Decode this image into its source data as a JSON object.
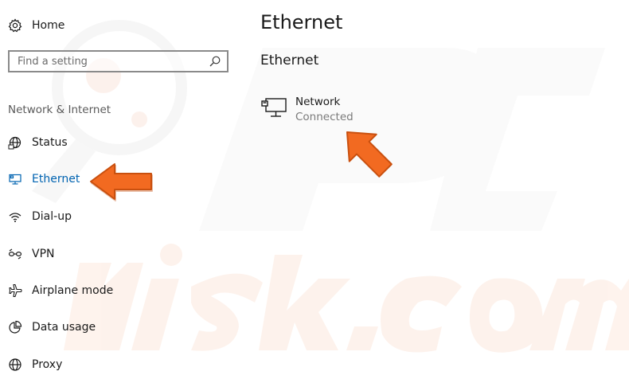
{
  "sidebar": {
    "home_label": "Home",
    "search": {
      "placeholder": "Find a setting"
    },
    "section_title": "Network & Internet",
    "items": [
      {
        "label": "Status",
        "icon": "globe-status-icon"
      },
      {
        "label": "Ethernet",
        "icon": "ethernet-monitor-icon",
        "active": true
      },
      {
        "label": "Dial-up",
        "icon": "dialup-signal-icon"
      },
      {
        "label": "VPN",
        "icon": "vpn-chain-icon"
      },
      {
        "label": "Airplane mode",
        "icon": "airplane-icon"
      },
      {
        "label": "Data usage",
        "icon": "pie-chart-icon"
      },
      {
        "label": "Proxy",
        "icon": "globe-icon"
      }
    ]
  },
  "main": {
    "title": "Ethernet",
    "subtitle": "Ethernet",
    "network": {
      "name": "Network",
      "status": "Connected",
      "icon": "wired-network-icon"
    }
  },
  "colors": {
    "accent": "#0063b1",
    "arrow": "#f26a21",
    "text": "#1a1a1a",
    "muted": "#7a7a7a"
  }
}
